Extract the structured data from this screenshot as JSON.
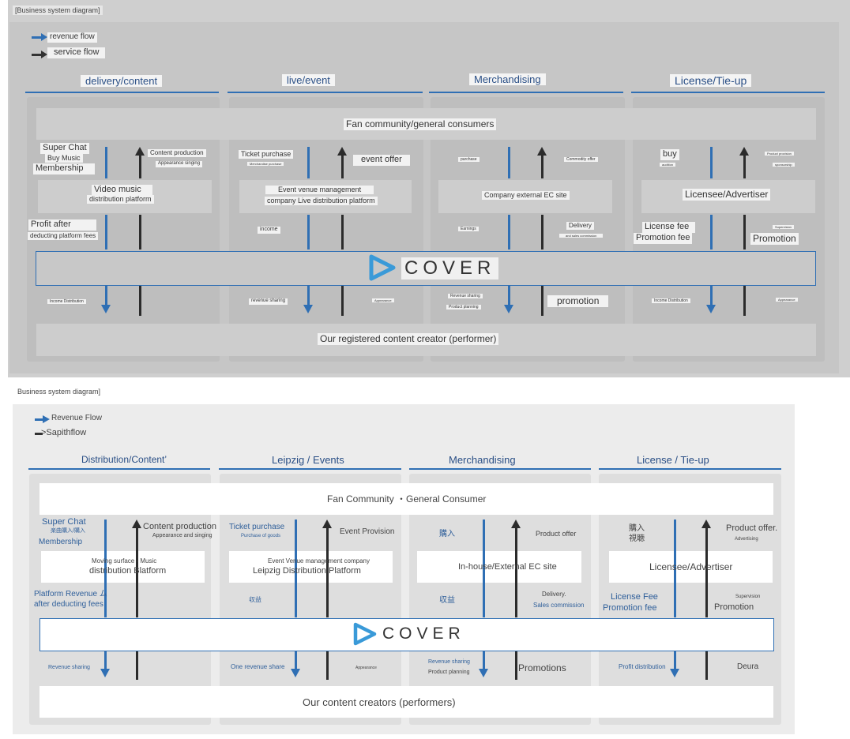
{
  "top": {
    "title": "[Business system diagram]",
    "legend": {
      "revenue": "revenue flow",
      "service": "service flow"
    },
    "headers": [
      "delivery/content",
      "live/event",
      "Merchandising",
      "License/Tie-up"
    ],
    "fan_community": "Fan community/general consumers",
    "cover": "COVER",
    "creators": "Our registered content creator (performer)",
    "col1": {
      "super_chat": "Super Chat",
      "buy_music": "Buy Music",
      "membership": "Membership",
      "content_production": "Content production",
      "appearance_singing": "Appearance singing",
      "platform_l1": "Video music",
      "platform_l2": "distribution platform",
      "profit_l1": "Profit after",
      "profit_l2": "deducting platform fees",
      "income_distribution": "Income Distribution"
    },
    "col2": {
      "ticket_purchase": "Ticket purchase",
      "merchandise_purchase": "Merchandise purchase",
      "event_offer": "event offer",
      "venue_l1": "Event venue management",
      "venue_l2": "company Live distribution platform",
      "income": "income",
      "revenue_sharing": "revenue sharing",
      "appearance": "Appearance"
    },
    "col3": {
      "purchase": "purchase",
      "commodity_offer": "Commodity offer",
      "ec_site": "Company external EC site",
      "earnings": "Earnings",
      "delivery": "Delivery",
      "sales_commission": "and sales commission",
      "revenue_sharing": "Revenue sharing",
      "product_planning": "Product planning",
      "promotion": "promotion"
    },
    "col4": {
      "buy": "buy",
      "audition": "audition",
      "product_provision": "Product provision",
      "sponsorship": "sponsorship",
      "licensee": "Licensee/Advertiser",
      "license_fee": "License fee",
      "promotion_fee": "Promotion fee",
      "supervision": "Supervision",
      "promotion": "Promotion",
      "income_distribution": "Income Distribution",
      "appearance": "Appearance"
    }
  },
  "bottom": {
    "title": "Business system diagram]",
    "legend": {
      "revenue": "Revenue Flow",
      "service": ">Sapithflow"
    },
    "headers": [
      "Distribution/Content’",
      "Leipzig / Events",
      "Merchandising",
      "License / Tie-up"
    ],
    "fan_community": "Fan Community ・General Consumer",
    "cover": "COVER",
    "creators": "Our content creators (performers)",
    "col1": {
      "super_chat": "Super Chat",
      "buy_music": "楽曲購入/購入",
      "membership": "Membership",
      "content_production": "Content production",
      "appearance_singing": "Appearance and singing",
      "platform_l1": "Moving surface - Music",
      "platform_l2": "distribution Blatform",
      "profit_l1": "Platform Revenue ム",
      "profit_l2": "after deducting fees",
      "revenue_sharing": "Revenue sharing"
    },
    "col2": {
      "ticket_purchase": "Ticket purchase",
      "purchase_goods": "Purchase of goods",
      "event_provision": "Event Provision",
      "venue_l1": "Event Venue management company",
      "venue_l2": "Leipzig Distribution Platform",
      "income": "収益",
      "revenue_share": "One revenue share",
      "appearance": "Appearance"
    },
    "col3": {
      "purchase": "購入",
      "product_offer": "Product offer",
      "ec_site": "In-house/External EC site",
      "income": "収益",
      "delivery": "Delivery.",
      "sales_commission": "Sales commission",
      "revenue_sharing": "Revenue sharing",
      "product_planning": "Product planning",
      "promotions": "Promotions"
    },
    "col4": {
      "buy": "購入",
      "watch": "視聴",
      "product_offer": "Product offer.",
      "advertising": "Advertising",
      "licensee": "Licensee/Advertiser",
      "license_fee": "License Fee",
      "promotion_fee": "Promotion fee",
      "supervision": "Supervision",
      "promotion": "Promotion",
      "profit_distribution": "Profit distribution",
      "deura": "Deura"
    }
  }
}
